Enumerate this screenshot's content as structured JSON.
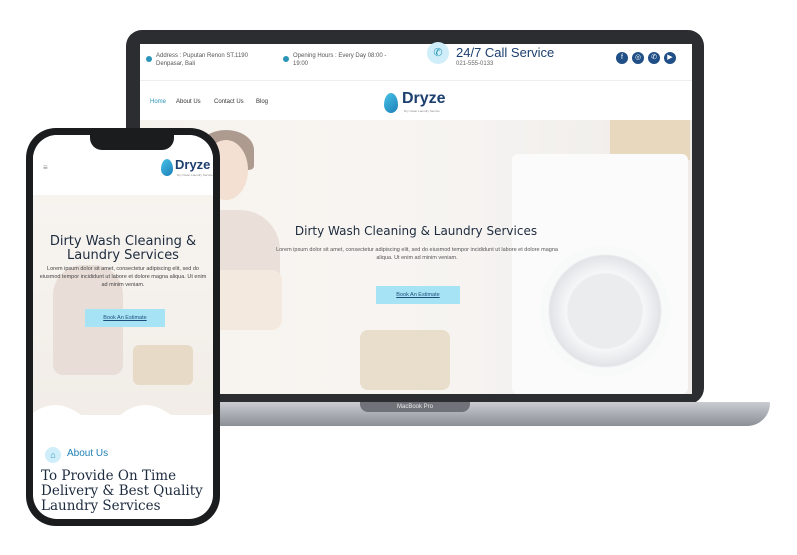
{
  "laptop": {
    "topbar": {
      "address": "Address : Puputan Renon ST.1190 Denpasar, Bali",
      "hours": "Opening Hours : Every Day 08:00 - 19:00",
      "social_icons": [
        "facebook-icon",
        "instagram-icon",
        "whatsapp-icon",
        "youtube-icon"
      ]
    },
    "nav": {
      "items": [
        "Home",
        "About Us",
        "Contact Us",
        "Blog"
      ]
    },
    "logo": {
      "name": "Dryze",
      "tagline": "Dry Clean Laundry Service"
    },
    "call": {
      "title": "24/7 Call Service",
      "phone": "021-555-0133"
    },
    "hero": {
      "title": "Dirty Wash Cleaning & Laundry Services",
      "text": "Lorem ipsum dolor sit amet, consectetur adipiscing elit, sed do eiusmod tempor incididunt ut labore et dolore magna aliqua. Ut enim ad minim veniam.",
      "button": "Book An Estimate"
    },
    "base_label": "MacBook Pro"
  },
  "phone": {
    "logo": {
      "name": "Dryze",
      "tagline": "Dry Clean Laundry Service"
    },
    "hero": {
      "title": "Dirty Wash Cleaning & Laundry Services",
      "text": "Lorem ipsum dolor sit amet, consectetur adipiscing elit, sed do eiusmod tempor incididunt ut labore et dolore magna aliqua. Ut enim ad minim veniam.",
      "button": "Book An Estimate"
    },
    "about": {
      "label": "About Us",
      "title": "To Provide On Time Delivery & Best Quality Laundry Services"
    }
  },
  "colors": {
    "accent": "#2a95b8",
    "button": "#a6e3f5",
    "heading": "#1d2b3e",
    "social": "#1f4f86"
  }
}
